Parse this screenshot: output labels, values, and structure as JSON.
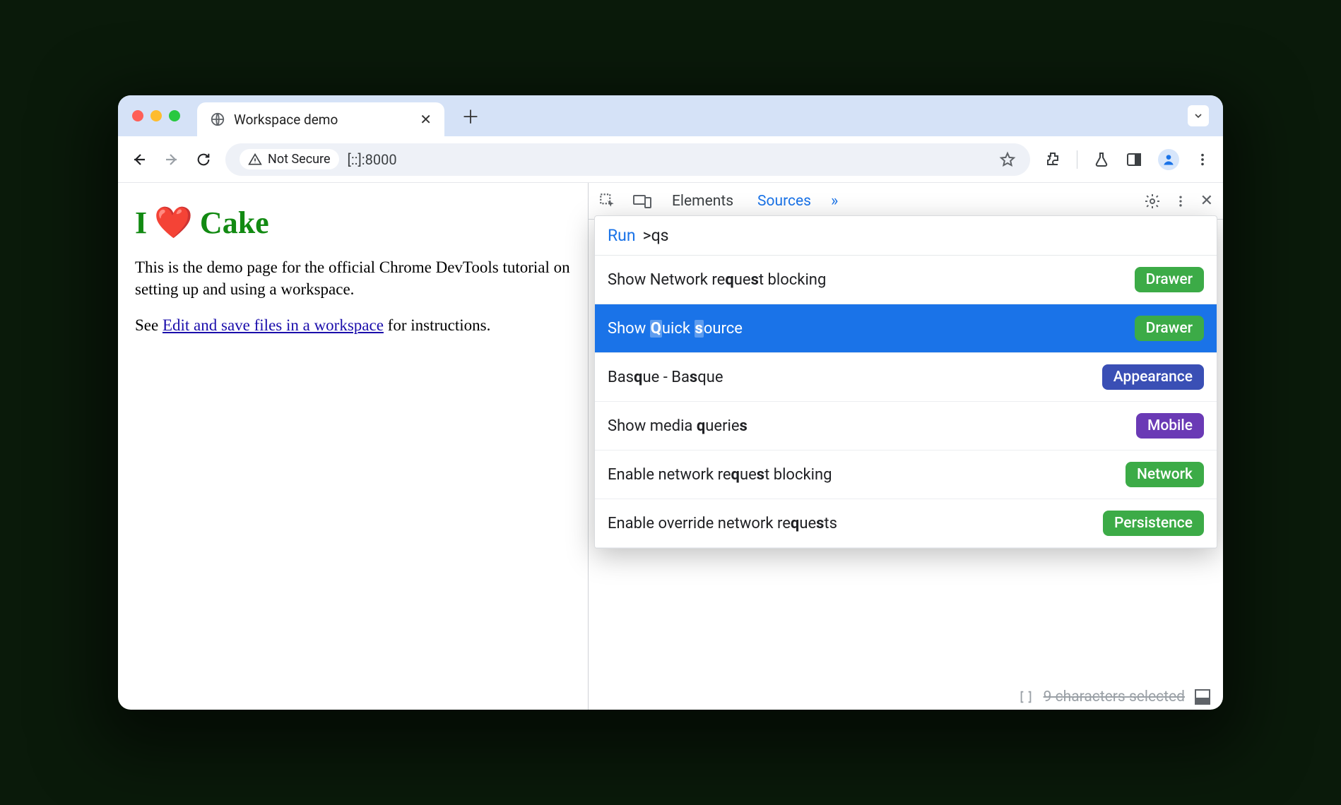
{
  "browserTab": {
    "title": "Workspace demo"
  },
  "omnibox": {
    "notSecure": "Not Secure",
    "url": "[::]:8000"
  },
  "page": {
    "heading_prefix": "I",
    "heading_suffix": "Cake",
    "para1": "This is the demo page for the official Chrome DevTools tutorial on setting up and using a workspace.",
    "para2_before": "See ",
    "link": "Edit and save files in a workspace",
    "para2_after": " for instructions."
  },
  "devtools": {
    "tabs": {
      "elements": "Elements",
      "sources": "Sources"
    },
    "commandMenu": {
      "runLabel": "Run",
      "query": ">qs",
      "items": [
        {
          "text": "Show Network request blocking",
          "badge": "Drawer",
          "badgeColor": "green",
          "selected": false
        },
        {
          "text": "Show Quick source",
          "badge": "Drawer",
          "badgeColor": "green",
          "selected": true
        },
        {
          "text": "Basque - Basque",
          "badge": "Appearance",
          "badgeColor": "blue",
          "selected": false
        },
        {
          "text": "Show media queries",
          "badge": "Mobile",
          "badgeColor": "purple",
          "selected": false
        },
        {
          "text": "Enable network request blocking",
          "badge": "Network",
          "badgeColor": "green",
          "selected": false
        },
        {
          "text": "Enable override network requests",
          "badge": "Persistence",
          "badgeColor": "green",
          "selected": false
        }
      ]
    },
    "footerPeek": "9 characters selected"
  }
}
